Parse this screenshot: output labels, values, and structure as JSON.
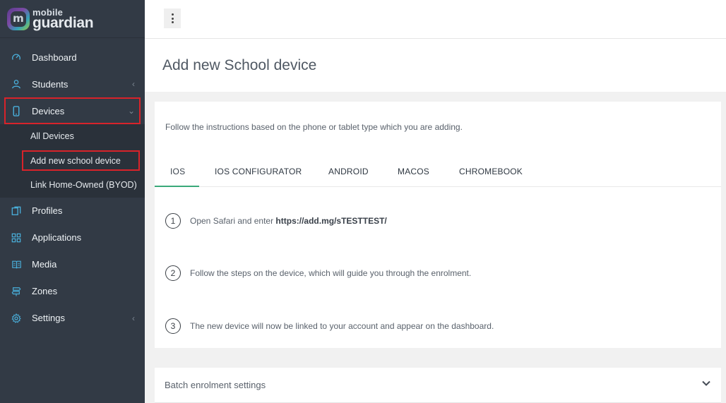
{
  "brand": {
    "top": "mobile",
    "bottom": "guardian",
    "mark": "m"
  },
  "sidebar": {
    "items": [
      {
        "label": "Dashboard",
        "icon": "dashboard-gauge-icon"
      },
      {
        "label": "Students",
        "icon": "student-user-icon"
      },
      {
        "label": "Devices",
        "icon": "phone-device-icon"
      },
      {
        "label": "Profiles",
        "icon": "profiles-copy-icon"
      },
      {
        "label": "Applications",
        "icon": "grid-apps-icon"
      },
      {
        "label": "Media",
        "icon": "book-media-icon"
      },
      {
        "label": "Zones",
        "icon": "signpost-zones-icon"
      },
      {
        "label": "Settings",
        "icon": "gear-settings-icon"
      }
    ],
    "devices_sub": [
      {
        "label": "All Devices"
      },
      {
        "label": "Add new school device"
      },
      {
        "label": "Link Home-Owned (BYOD)"
      }
    ]
  },
  "page": {
    "title": "Add new School device"
  },
  "card": {
    "intro": "Follow the instructions based on the phone or tablet type which you are adding.",
    "tabs": [
      "IOS",
      "IOS CONFIGURATOR",
      "ANDROID",
      "MACOS",
      "CHROMEBOOK"
    ],
    "active_tab": "IOS",
    "steps": [
      {
        "num": "1",
        "text": "Open Safari and enter ",
        "url": "https://add.mg/sTESTTEST/"
      },
      {
        "num": "2",
        "text": "Follow the steps on the device, which will guide you through the enrolment."
      },
      {
        "num": "3",
        "text": "The new device will now be linked to your account and appear on the dashboard."
      }
    ]
  },
  "batch": {
    "label": "Batch enrolment settings"
  },
  "colors": {
    "sidebar": "#323a45",
    "accent": "#4ab0dc",
    "highlight": "#d8232a",
    "tab_active": "#3aa97a"
  }
}
